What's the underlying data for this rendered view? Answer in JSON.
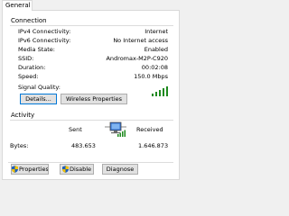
{
  "tabs": [
    {
      "label": "General"
    }
  ],
  "connection": {
    "title": "Connection",
    "rows": [
      {
        "label": "IPv4 Connectivity:",
        "value": "Internet"
      },
      {
        "label": "IPv6 Connectivity:",
        "value": "No Internet access"
      },
      {
        "label": "Media State:",
        "value": "Enabled"
      },
      {
        "label": "SSID:",
        "value": "Andromax-M2P-C920"
      },
      {
        "label": "Duration:",
        "value": "00:02:08"
      },
      {
        "label": "Speed:",
        "value": "150.0 Mbps"
      }
    ],
    "signal_quality_label": "Signal Quality:",
    "signal_bars_filled": 5,
    "signal_bars_total": 5,
    "buttons": {
      "details": "Details...",
      "wireless_properties": "Wireless Properties"
    }
  },
  "activity": {
    "title": "Activity",
    "sent_label": "Sent",
    "received_label": "Received",
    "bytes_label": "Bytes:",
    "bytes_sent": "483.653",
    "bytes_received": "1.646.873"
  },
  "bottom_buttons": {
    "properties": "Properties",
    "disable": "Disable",
    "diagnose": "Diagnose"
  },
  "colors": {
    "signal": "#1f8a1f",
    "focus": "#0078d7",
    "shield_blue": "#1e5fbf",
    "shield_yellow": "#f2c200"
  }
}
